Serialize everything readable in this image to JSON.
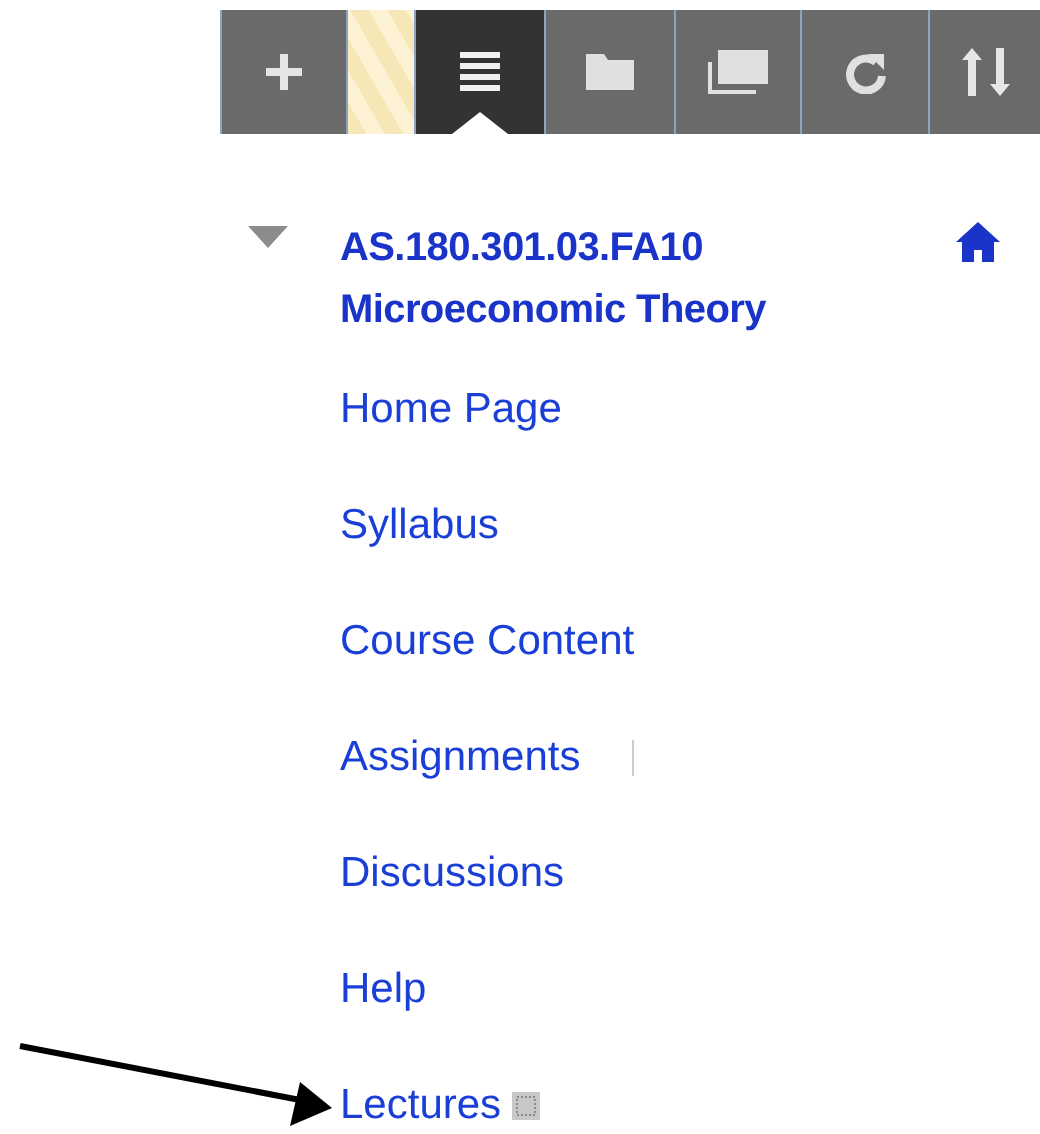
{
  "toolbar": [
    {
      "kind": "add",
      "selected": false
    },
    {
      "kind": "handle",
      "selected": false
    },
    {
      "kind": "list",
      "selected": true
    },
    {
      "kind": "folder",
      "selected": false
    },
    {
      "kind": "windows",
      "selected": false
    },
    {
      "kind": "refresh",
      "selected": false
    },
    {
      "kind": "sort",
      "selected": false
    }
  ],
  "course": {
    "expanded": true,
    "code": "AS.180.301.03.FA10",
    "name": "Microeconomic Theory"
  },
  "menu_items": [
    {
      "label": "Home Page",
      "kind": "link"
    },
    {
      "label": "Syllabus",
      "kind": "link"
    },
    {
      "label": "Course Content",
      "kind": "link"
    },
    {
      "label": "Assignments",
      "kind": "link-with-separator"
    },
    {
      "label": "Discussions",
      "kind": "link"
    },
    {
      "label": "Help",
      "kind": "link"
    },
    {
      "label": "Lectures",
      "kind": "link-with-icon"
    }
  ],
  "annotation": {
    "kind": "arrow"
  }
}
